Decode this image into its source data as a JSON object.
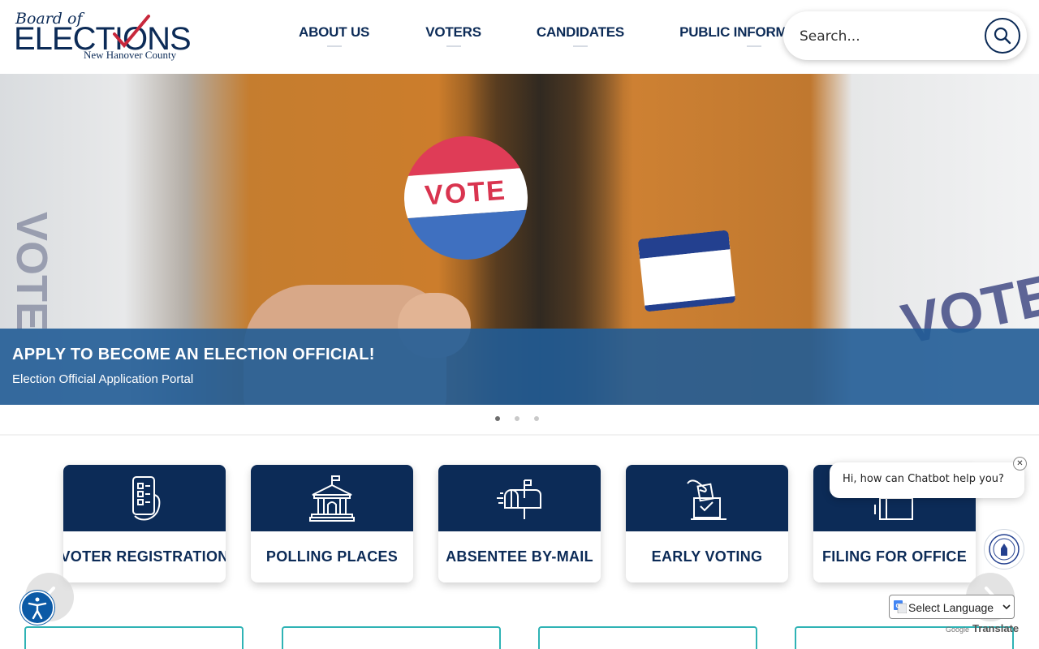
{
  "logo": {
    "line1": "Board of",
    "line2": "ELECTIONS",
    "line3": "New Hanover County"
  },
  "nav": [
    {
      "label": "ABOUT US"
    },
    {
      "label": "VOTERS"
    },
    {
      "label": "CANDIDATES"
    },
    {
      "label": "PUBLIC INFORMATION"
    }
  ],
  "search": {
    "placeholder": "Search...",
    "button_icon": "search-icon"
  },
  "hero": {
    "sticker_text": "VOTE",
    "ghost_left_text": "VOTE",
    "ghost_right_text": "VOTE",
    "title": "APPLY TO BECOME AN ELECTION OFFICIAL!",
    "link": "Election Official Application Portal",
    "slides": 3,
    "active_slide": 1
  },
  "quick_links": [
    {
      "label": "VOTER REGISTRATION",
      "icon": "phone-checklist-icon"
    },
    {
      "label": "POLLING PLACES",
      "icon": "building-icon"
    },
    {
      "label": "ABSENTEE BY-MAIL",
      "icon": "mailbox-icon"
    },
    {
      "label": "EARLY VOTING",
      "icon": "ballot-box-icon"
    },
    {
      "label": "FILING FOR OFFICE",
      "icon": "document-icon"
    }
  ],
  "chatbot": {
    "message": "Hi, how can Chatbot help you?",
    "close": "✕"
  },
  "translate": {
    "select_label": "Select Language",
    "powered_google": "Google",
    "powered_translate": "Translate"
  },
  "colors": {
    "brand_navy": "#0c2b57",
    "caption_blue": "#215c96",
    "teal": "#2fb3b5",
    "check_red": "#c8283c"
  }
}
